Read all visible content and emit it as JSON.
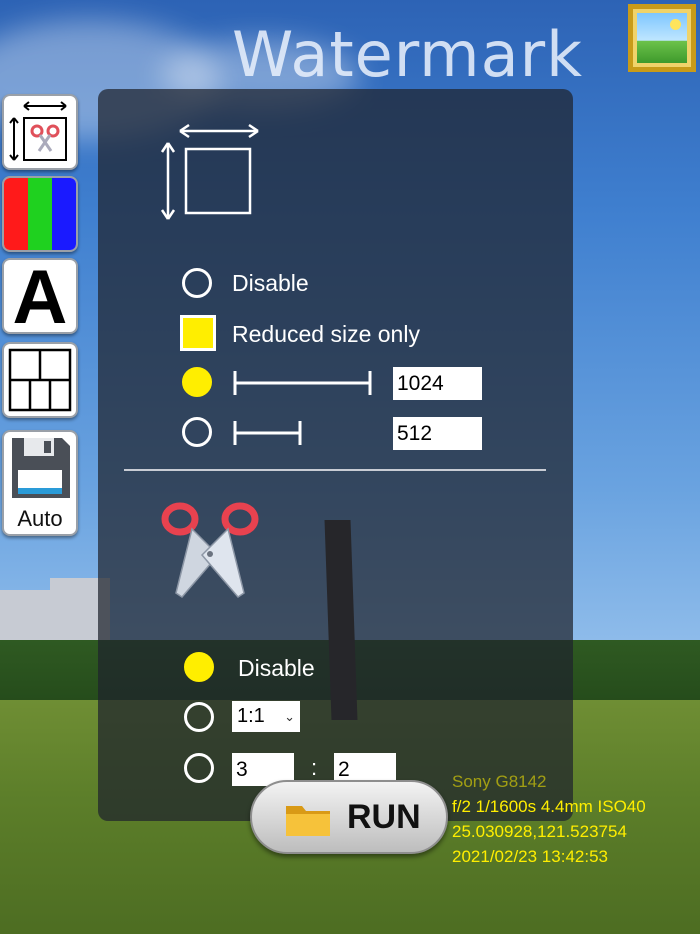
{
  "app": {
    "title": "Watermark"
  },
  "toolbar": {
    "items": [
      {
        "name": "resize-crop"
      },
      {
        "name": "color-channels"
      },
      {
        "name": "text",
        "glyph": "A"
      },
      {
        "name": "layout"
      },
      {
        "name": "save",
        "label": "Auto"
      }
    ]
  },
  "resize": {
    "options": [
      {
        "label": "Disable",
        "selected": false
      },
      {
        "label": "Reduced size only",
        "checked": true
      },
      {
        "value": "1024",
        "selected": true
      },
      {
        "value": "512",
        "selected": false
      }
    ]
  },
  "crop": {
    "disable_label": "Disable",
    "ratio_select": "1:1",
    "custom_w": "3",
    "custom_h": "2",
    "separator": ":"
  },
  "run": {
    "label": "RUN"
  },
  "exif": {
    "camera": "Sony G8142",
    "exposure": "f/2 1/1600s 4.4mm ISO40",
    "gps": "25.030928,121.523754",
    "datetime": "2021/02/23 13:42:53"
  },
  "colors": {
    "accent": "#ffee00",
    "panel": "#1e222c",
    "exif_text": "#ffee00"
  }
}
